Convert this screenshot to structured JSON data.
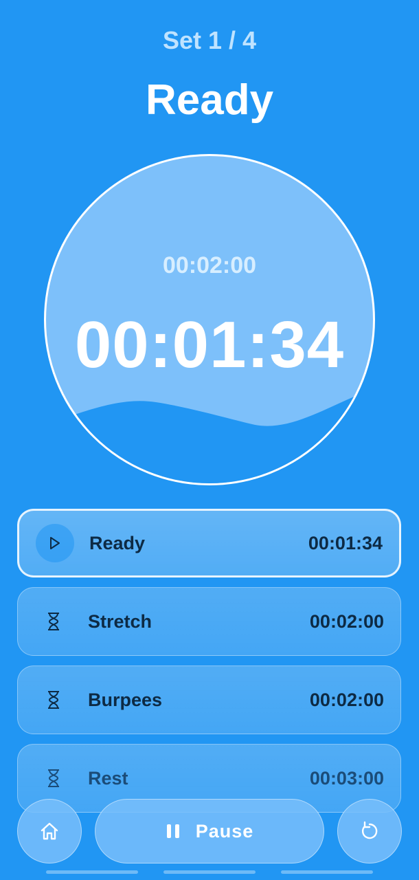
{
  "header": {
    "set_label": "Set 1 / 4",
    "phase_title": "Ready"
  },
  "dial": {
    "total_time": "00:02:00",
    "remaining_time": "00:01:34"
  },
  "steps": [
    {
      "name": "Ready",
      "time": "00:01:34",
      "icon": "play-icon",
      "active": true
    },
    {
      "name": "Stretch",
      "time": "00:02:00",
      "icon": "hourglass-icon",
      "active": false
    },
    {
      "name": "Burpees",
      "time": "00:02:00",
      "icon": "hourglass-icon",
      "active": false
    },
    {
      "name": "Rest",
      "time": "00:03:00",
      "icon": "hourglass-icon",
      "active": false
    }
  ],
  "controls": {
    "home_icon": "home-icon",
    "pause_label": "Pause",
    "pause_icon": "pause-icon",
    "restart_icon": "restart-icon"
  },
  "colors": {
    "background": "#2196F3",
    "dial_fill": "#7DC0FA",
    "text_dark": "#0D2A44"
  }
}
